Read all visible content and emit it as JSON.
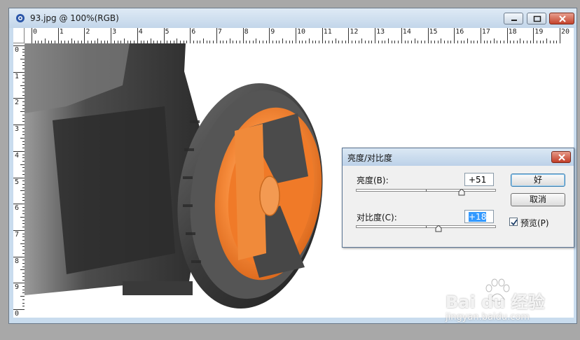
{
  "window": {
    "title": "93.jpg @ 100%(RGB)",
    "controls": {
      "minimize": "minimize",
      "maximize": "maximize",
      "close": "close"
    }
  },
  "ruler": {
    "top_labels": [
      "0",
      "1",
      "2",
      "3",
      "4",
      "5",
      "6",
      "7",
      "8",
      "9",
      "10",
      "11",
      "12",
      "13",
      "14",
      "15",
      "16",
      "17",
      "18",
      "19",
      "20"
    ],
    "left_labels": [
      "0",
      "1",
      "2",
      "3",
      "4",
      "5",
      "6",
      "7",
      "8",
      "9",
      "0"
    ]
  },
  "dialog": {
    "title": "亮度/对比度",
    "brightness": {
      "label": "亮度(B):",
      "value": "+51",
      "slider_fraction": 0.755
    },
    "contrast": {
      "label": "对比度(C):",
      "value": "+18",
      "slider_fraction": 0.59
    },
    "ok_label": "好",
    "cancel_label": "取消",
    "preview": {
      "label": "预览(P)",
      "checked": true
    }
  },
  "watermark": {
    "brand": "Bai du 经验",
    "url": "jingyan.baidu.com"
  },
  "colors": {
    "wheel_orange": "#f0883a",
    "tire_dark": "#3a3a3a",
    "selection_blue": "#3399ff"
  }
}
